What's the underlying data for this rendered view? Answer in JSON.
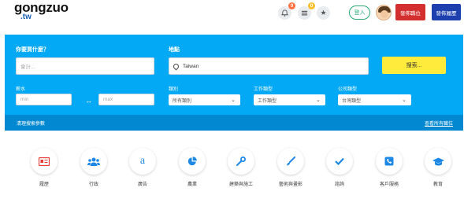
{
  "header": {
    "logo_main": "gongzuo",
    "logo_sub": ".tw",
    "icons": [
      {
        "name": "bell-icon",
        "badge": "0",
        "badge_color": "#ff7043"
      },
      {
        "name": "list-icon",
        "badge": "0",
        "badge_color": "#fbc02d"
      },
      {
        "name": "star-icon",
        "badge": "",
        "badge_color": ""
      }
    ],
    "login_label": "登入",
    "post_job_label": "發佈職位",
    "post_resume_label": "發佈履歷"
  },
  "search": {
    "what_label": "你要買什麼？",
    "what_placeholder": "會計...",
    "where_label": "地點",
    "where_value": "Taiwan",
    "search_button": "搜索...",
    "salary_label": "薪水",
    "min_placeholder": "min",
    "max_placeholder": "max",
    "category_label": "類別",
    "category_value": "所有類別",
    "job_type_label": "工作類型",
    "job_type_value": "工作類型",
    "company_type_label": "公司類型",
    "company_type_value": "台灣類型",
    "clear_label": "清理搜索參數",
    "view_all_label": "查看所有職位"
  },
  "categories": [
    {
      "label": "履歷",
      "icon": "id-card-icon"
    },
    {
      "label": "行政",
      "icon": "users-icon"
    },
    {
      "label": "廣告",
      "icon": "amazon-icon"
    },
    {
      "label": "農業",
      "icon": "pie-chart-icon"
    },
    {
      "label": "建築與施工",
      "icon": "wrench-icon"
    },
    {
      "label": "藝術與畫影",
      "icon": "paintbrush-icon"
    },
    {
      "label": "諮詢",
      "icon": "check-icon"
    },
    {
      "label": "客戶服務",
      "icon": "phone-icon"
    },
    {
      "label": "教育",
      "icon": "graduation-cap-icon"
    }
  ],
  "colors": {
    "panel": "#03a9f4",
    "panel_footer": "#0288d1",
    "search_button": "#ffeb3b",
    "post_job": "#d32f2f",
    "post_resume": "#1e40af",
    "login": "#2aa876",
    "icon": "#1e88e5"
  }
}
